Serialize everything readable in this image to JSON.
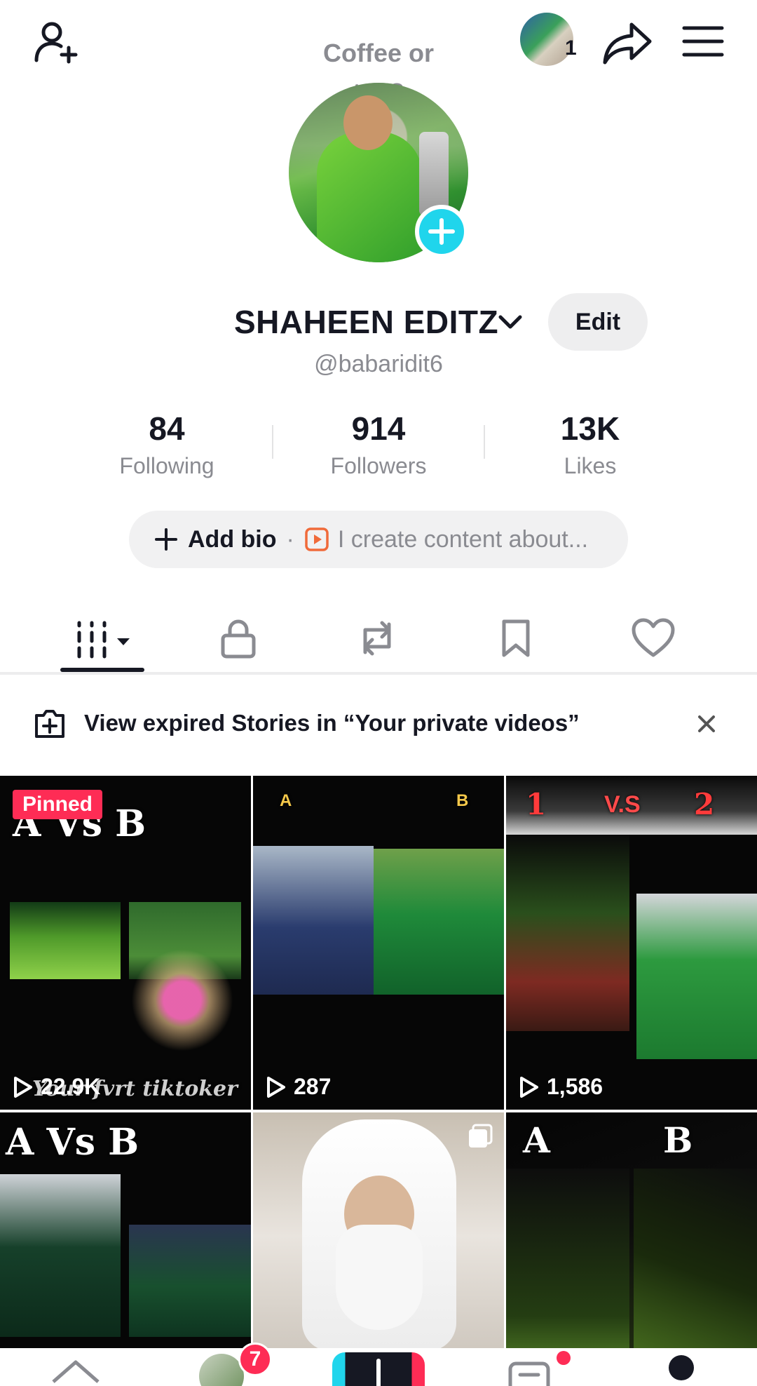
{
  "header": {
    "story_prompt": "Coffee or tea?",
    "notifications_count": "1"
  },
  "profile": {
    "display_name": "SHAHEEN EDITZ",
    "edit_label": "Edit",
    "username": "@babaridit6"
  },
  "stats": [
    {
      "value": "84",
      "label": "Following"
    },
    {
      "value": "914",
      "label": "Followers"
    },
    {
      "value": "13K",
      "label": "Likes"
    }
  ],
  "bio": {
    "add_label": "Add bio",
    "separator": "·",
    "hint": "I create content about..."
  },
  "tabs": [
    {
      "icon": "grid-icon",
      "active": true
    },
    {
      "icon": "lock-icon"
    },
    {
      "icon": "repost-icon"
    },
    {
      "icon": "bookmark-icon"
    },
    {
      "icon": "heart-icon"
    }
  ],
  "banner": {
    "text": "View expired Stories in “Your private videos”"
  },
  "videos": [
    {
      "views": "22.9K",
      "pinned_label": "Pinned",
      "title": "A Vs B",
      "caption": "Your fvrt tiktoker"
    },
    {
      "views": "287",
      "title_left": "A",
      "title_right": "B"
    },
    {
      "views": "1,586",
      "left": "1",
      "mid": "V.S",
      "right": "2"
    },
    {
      "title": "A Vs B"
    },
    {},
    {
      "title_left": "A",
      "title_right": "B"
    }
  ],
  "bottom_nav": {
    "inbox_badge": "7"
  },
  "colors": {
    "accent_red": "#fe2c55",
    "accent_cyan": "#20d5ec",
    "muted_text": "#8a8b91"
  }
}
